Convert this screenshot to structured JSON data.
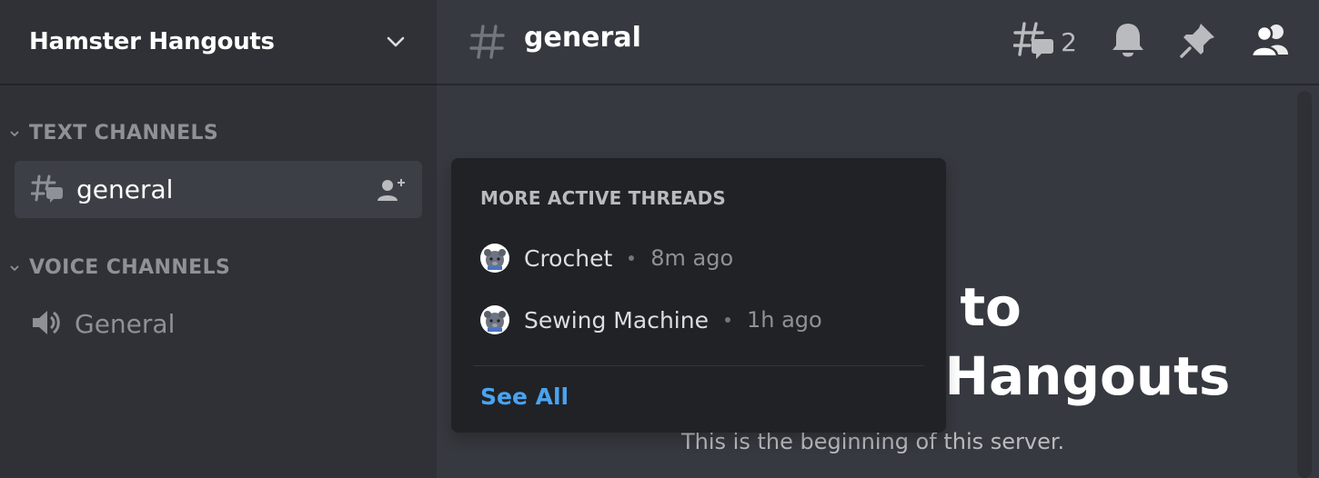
{
  "server": {
    "name": "Hamster Hangouts"
  },
  "categories": {
    "text": {
      "label": "TEXT CHANNELS"
    },
    "voice": {
      "label": "VOICE CHANNELS"
    }
  },
  "channels": {
    "active_text": {
      "name": "general"
    },
    "voice": {
      "name": "General"
    }
  },
  "header": {
    "channel_name": "general",
    "thread_count": "2"
  },
  "welcome": {
    "title_line1": "Welcome to",
    "title_line2": "Hamster Hangouts",
    "subtitle": "This is the beginning of this server."
  },
  "threads_popup": {
    "title": "MORE ACTIVE THREADS",
    "threads": [
      {
        "name": "Crochet",
        "time": "8m ago"
      },
      {
        "name": "Sewing Machine",
        "time": "1h ago"
      }
    ],
    "see_all": "See All"
  },
  "colors": {
    "background": "#36393f",
    "sidebar": "#2f3136",
    "popup": "#202225",
    "link": "#4aa3f0"
  }
}
